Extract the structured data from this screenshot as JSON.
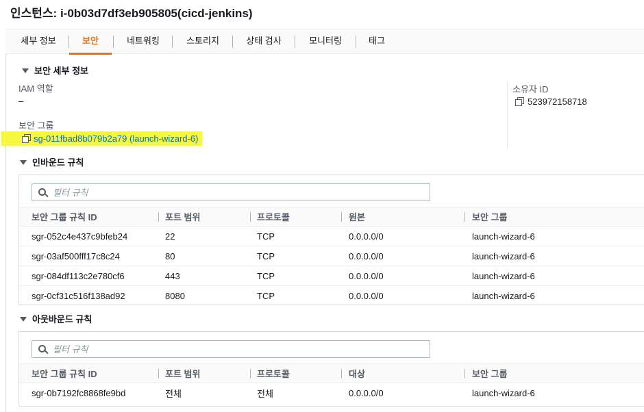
{
  "title": "인스턴스: i-0b03d7df3eb905805(cicd-jenkins)",
  "tabs": [
    "세부 정보",
    "보안",
    "네트워킹",
    "스토리지",
    "상태 검사",
    "모니터링",
    "태그"
  ],
  "active_tab": "보안",
  "security_details": {
    "heading": "보안 세부 정보",
    "iam_role_label": "IAM 역할",
    "iam_role_value": "–",
    "security_group_label": "보안 그룹",
    "security_group_link": "sg-011fbad8b079b2a79 (launch-wizard-6)",
    "owner_label": "소유자 ID",
    "owner_value": "523972158718",
    "highlight_color": "#f6f740"
  },
  "inbound": {
    "heading": "인바운드 규칙",
    "filter_placeholder": "필터 규칙",
    "columns": [
      "보안 그룹 규칙 ID",
      "포트 범위",
      "프로토콜",
      "원본",
      "보안 그룹"
    ],
    "rows": [
      [
        "sgr-052c4e437c9bfeb24",
        "22",
        "TCP",
        "0.0.0.0/0",
        "launch-wizard-6"
      ],
      [
        "sgr-03af500fff17c8c24",
        "80",
        "TCP",
        "0.0.0.0/0",
        "launch-wizard-6"
      ],
      [
        "sgr-084df113c2e780cf6",
        "443",
        "TCP",
        "0.0.0.0/0",
        "launch-wizard-6"
      ],
      [
        "sgr-0cf31c516f138ad92",
        "8080",
        "TCP",
        "0.0.0.0/0",
        "launch-wizard-6"
      ]
    ]
  },
  "outbound": {
    "heading": "아웃바운드 규칙",
    "filter_placeholder": "필터 규칙",
    "columns": [
      "보안 그룹 규칙 ID",
      "포트 범위",
      "프로토콜",
      "대상",
      "보안 그룹"
    ],
    "rows": [
      [
        "sgr-0b7192fc8868fe9bd",
        "전체",
        "전체",
        "0.0.0.0/0",
        "launch-wizard-6"
      ]
    ]
  },
  "colors": {
    "accent": "#ec7211",
    "link": "#0073bb"
  }
}
